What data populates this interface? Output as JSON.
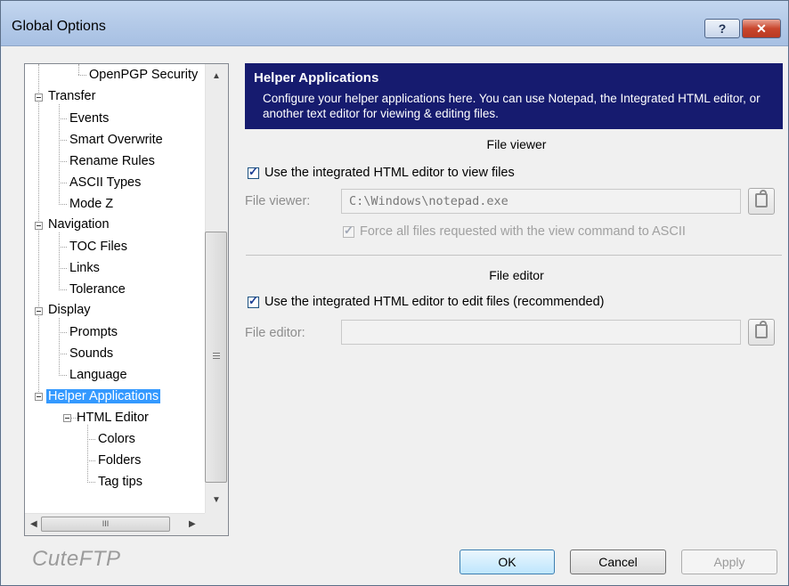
{
  "window": {
    "title": "Global Options",
    "help_label": "?",
    "close_label": "✕"
  },
  "tree": {
    "items": [
      {
        "label": "OpenPGP Security"
      },
      {
        "label": "Transfer"
      },
      {
        "label": "Events"
      },
      {
        "label": "Smart Overwrite"
      },
      {
        "label": "Rename Rules"
      },
      {
        "label": "ASCII Types"
      },
      {
        "label": "Mode Z"
      },
      {
        "label": "Navigation"
      },
      {
        "label": "TOC Files"
      },
      {
        "label": "Links"
      },
      {
        "label": "Tolerance"
      },
      {
        "label": "Display"
      },
      {
        "label": "Prompts"
      },
      {
        "label": "Sounds"
      },
      {
        "label": "Language"
      },
      {
        "label": "Helper Applications"
      },
      {
        "label": "HTML Editor"
      },
      {
        "label": "Colors"
      },
      {
        "label": "Folders"
      },
      {
        "label": "Tag tips"
      }
    ],
    "selected": "Helper Applications",
    "hscroll_grip": "III"
  },
  "panel": {
    "title": "Helper Applications",
    "description": "Configure your helper applications here. You can use Notepad, the Integrated HTML editor, or another text editor for viewing & editing files.",
    "viewer": {
      "section": "File viewer",
      "use_integrated_label": "Use the integrated HTML editor to view files",
      "use_integrated_checked": true,
      "field_label": "File viewer:",
      "field_value": "C:\\Windows\\notepad.exe",
      "force_ascii_label": "Force all files requested with the view command to ASCII",
      "force_ascii_checked": true
    },
    "editor": {
      "section": "File editor",
      "use_integrated_label": "Use the integrated HTML editor to edit files (recommended)",
      "use_integrated_checked": true,
      "field_label": "File editor:",
      "field_value": ""
    }
  },
  "footer": {
    "brand": "CuteFTP",
    "ok_label": "OK",
    "cancel_label": "Cancel",
    "apply_label": "Apply"
  }
}
